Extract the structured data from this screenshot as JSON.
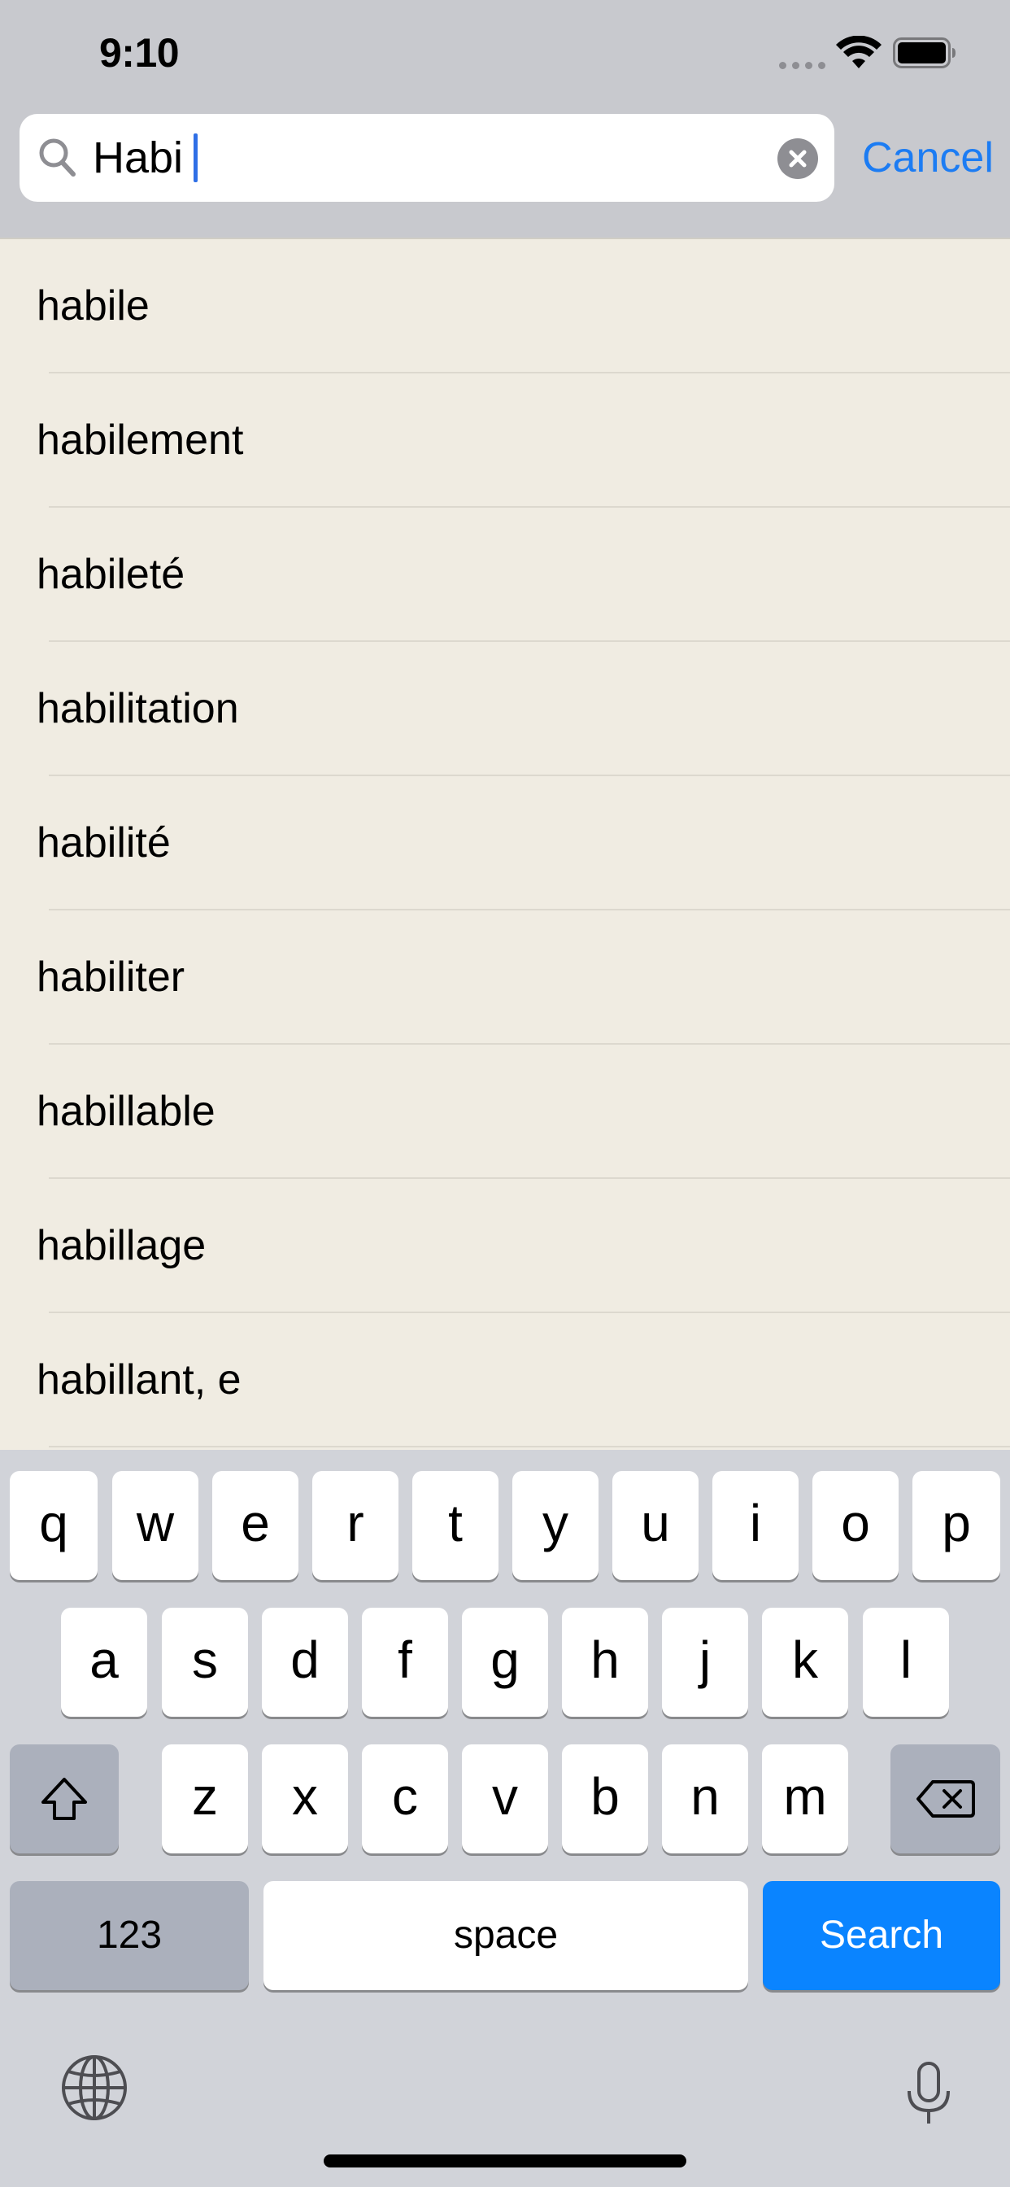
{
  "status_bar": {
    "time": "9:10",
    "icons": [
      "signal-icon",
      "wifi-icon",
      "battery-icon"
    ]
  },
  "search": {
    "value": "Habi",
    "cancel_label": "Cancel",
    "icons": [
      "search-icon",
      "clear-icon"
    ]
  },
  "suggestions": [
    "habile",
    "habilement",
    "habileté",
    "habilitation",
    "habilité",
    "habiliter",
    "habillable",
    "habillage",
    "habillant, e"
  ],
  "keyboard": {
    "row1": [
      "q",
      "w",
      "e",
      "r",
      "t",
      "y",
      "u",
      "i",
      "o",
      "p"
    ],
    "row2": [
      "a",
      "s",
      "d",
      "f",
      "g",
      "h",
      "j",
      "k",
      "l"
    ],
    "row3": [
      "z",
      "x",
      "c",
      "v",
      "b",
      "n",
      "m"
    ],
    "numbers_label": "123",
    "space_label": "space",
    "search_label": "Search",
    "icons": [
      "shift-icon",
      "delete-icon",
      "globe-icon",
      "microphone-icon"
    ]
  },
  "colors": {
    "accent": "#1c7cf3",
    "search_key": "#0a84ff",
    "list_background": "#f0ece2",
    "keyboard_background": "#d1d3d9"
  }
}
